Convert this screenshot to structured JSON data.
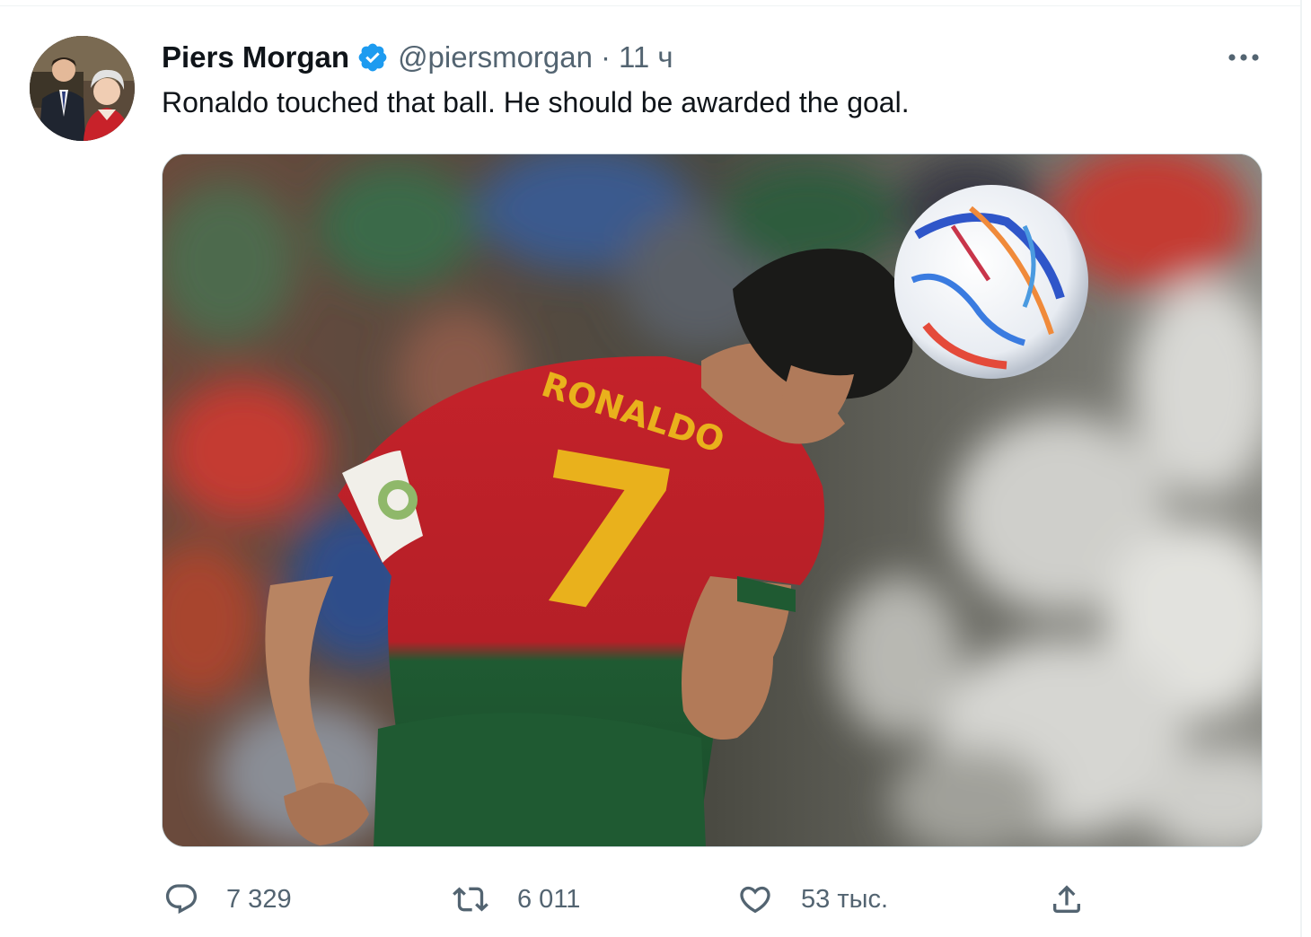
{
  "tweet": {
    "author_name": "Piers Morgan",
    "handle": "@piersmorgan",
    "separator": "·",
    "timestamp": "11 ч",
    "text": "Ronaldo touched that ball. He should be awarded the goal.",
    "media": {
      "jersey_name": "RONALDO",
      "jersey_number": "7"
    }
  },
  "actions": {
    "reply": {
      "icon": "reply-icon",
      "count": "7 329"
    },
    "retweet": {
      "icon": "retweet-icon",
      "count": "6 011"
    },
    "like": {
      "icon": "heart-icon",
      "count": "53 тыс."
    },
    "share": {
      "icon": "share-icon"
    }
  },
  "colors": {
    "verified": "#1d9bf0",
    "text": "#0f1419",
    "secondary": "#536471",
    "border": "#cfd9de"
  }
}
